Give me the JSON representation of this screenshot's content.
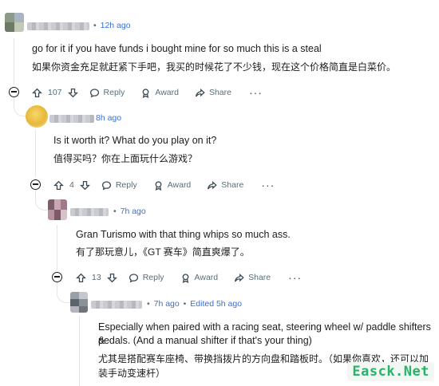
{
  "comments": [
    {
      "time": "12h ago",
      "text_en": "go for it if you have funds i bought mine for so much this is a steal",
      "text_zh": "如果你资金充足就赶紧下手吧，我买的时候花了不少钱，现在这个价格简直是白菜价。",
      "votes": "107"
    },
    {
      "time": "8h ago",
      "text_en": "Is it worth it? What do you play on it?",
      "text_zh": "值得买吗？你在上面玩什么游戏？",
      "votes": "4"
    },
    {
      "time": "7h ago",
      "text_en": "Gran Turismo with that thing whips so much ass.",
      "text_zh": "有了那玩意儿，《GT 赛车》简直爽爆了。",
      "votes": "13"
    },
    {
      "time": "7h ago",
      "edited": "Edited 5h ago",
      "text_en_1": "Especially when paired with a racing seat, steering wheel w/ paddle shifters &",
      "text_en_2": "pedals. (And a manual shifter if that's your thing)",
      "text_zh_1": "尤其是搭配赛车座椅、带换挡拨片的方向盘和踏板时。（如果你喜欢，还可以加",
      "text_zh_2": "装手动变速杆）"
    }
  ],
  "actions": {
    "reply": "Reply",
    "award": "Award",
    "share": "Share",
    "more": "···"
  },
  "dot": "•",
  "watermark": "Easck.Net",
  "colors": {
    "link": "#3a6fd6",
    "meta": "#576f76",
    "watermark": "#27b36a"
  }
}
